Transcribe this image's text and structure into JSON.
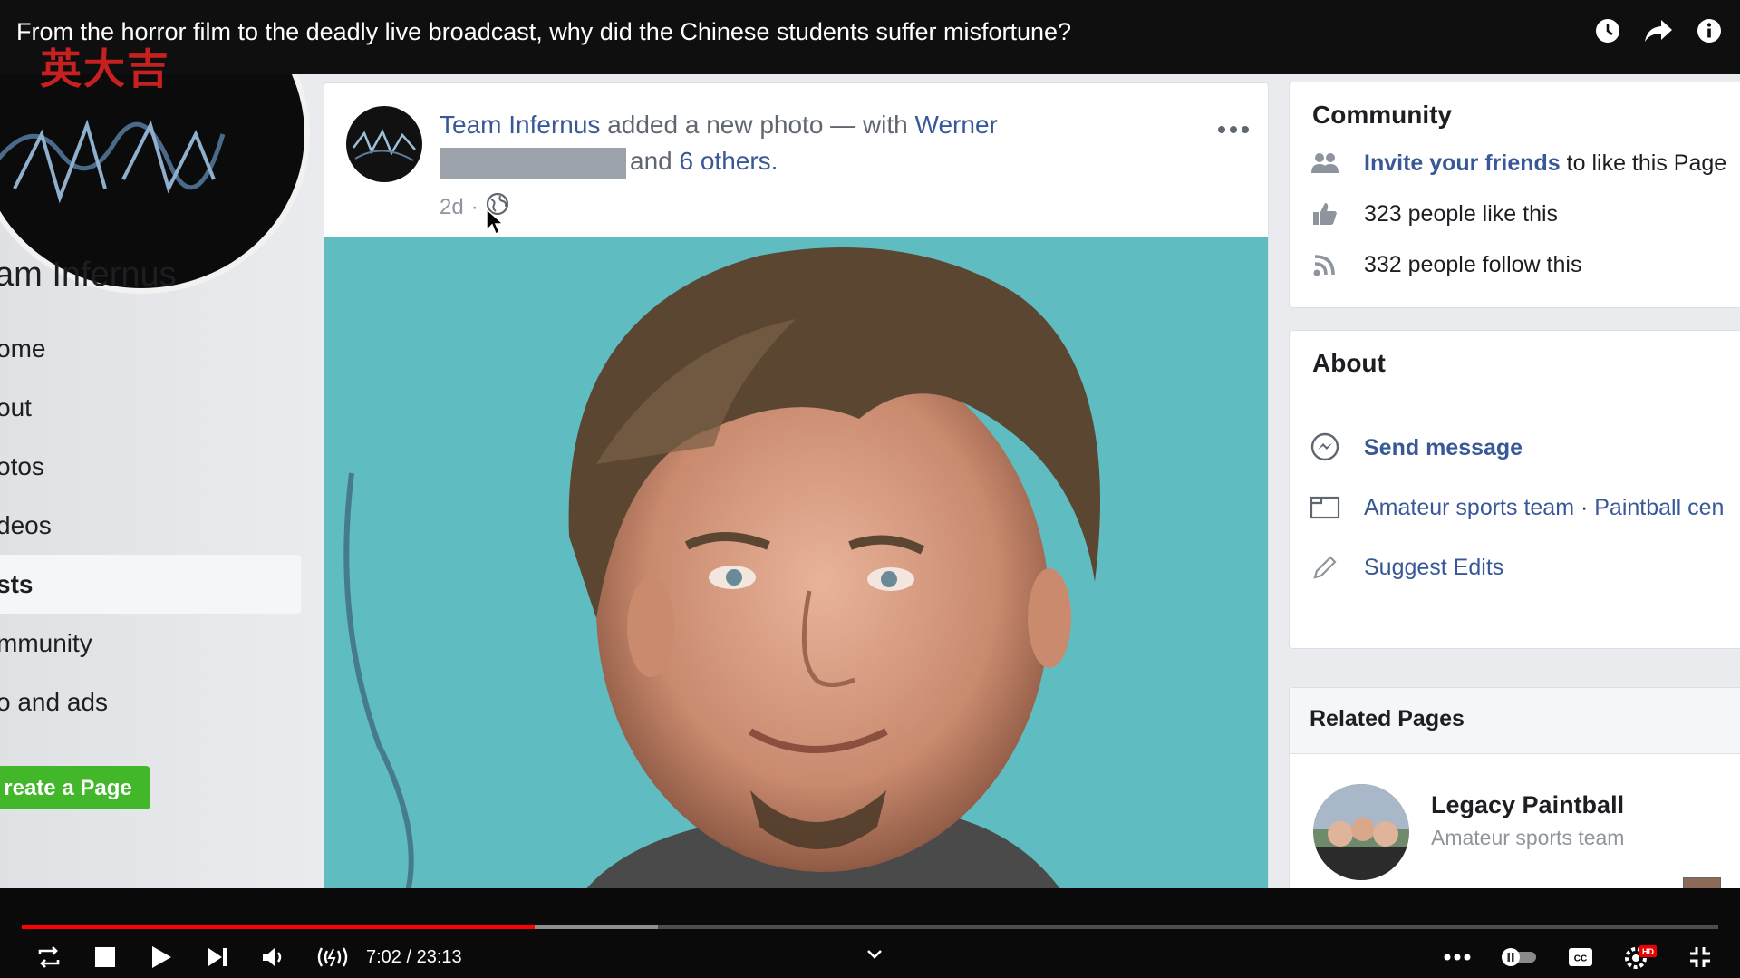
{
  "video": {
    "title": "From the horror film to the deadly live broadcast, why did the Chinese students suffer misfortune?",
    "channel_logo_text": "英大吉",
    "current_time": "7:02",
    "duration": "23:13",
    "time_display": "7:02 / 23:13",
    "progress": 0.3025,
    "buffered": 0.375,
    "accent": "#ff0000"
  },
  "facebook": {
    "page_name": "am Infernus",
    "nav": [
      {
        "label": "ome"
      },
      {
        "label": "out"
      },
      {
        "label": "otos"
      },
      {
        "label": "deos"
      },
      {
        "label": "sts",
        "active": true
      },
      {
        "label": "mmunity"
      },
      {
        "label": "o and ads"
      }
    ],
    "create_page_label": "reate a Page",
    "post": {
      "author": "Team Infernus",
      "action": " added a new photo — with ",
      "tagged": "Werner",
      "and_text": "and ",
      "others": "6 others.",
      "time": "2d",
      "separator": "·"
    },
    "community": {
      "title": "Community",
      "invite_link": "Invite your friends",
      "invite_rest": " to like this Page",
      "likes": "323 people like this",
      "follows": "332 people follow this"
    },
    "about": {
      "title": "About",
      "send_message": "Send message",
      "category_1": "Amateur sports team",
      "category_sep": " · ",
      "category_2": "Paintball cen",
      "suggest_edits": "Suggest Edits"
    },
    "related": {
      "title": "Related Pages",
      "items": [
        {
          "name": "Legacy Paintball",
          "category": "Amateur sports team"
        }
      ]
    }
  }
}
